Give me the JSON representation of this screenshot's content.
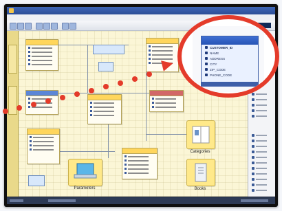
{
  "callout": {
    "entity_title": "CUSTOMERS",
    "fields": [
      "CUSTOMER_ID",
      "NAME",
      "ADDRESS",
      "CITY",
      "ZIP_CODE",
      "PHONE_CODE"
    ]
  },
  "canvas": {
    "illustrations": [
      {
        "caption": "Parameters"
      },
      {
        "caption": "Categories"
      },
      {
        "caption": "Books"
      }
    ]
  },
  "colors": {
    "callout_red": "#e43b2a",
    "entity_header_yellow": "#ffd65c",
    "entity_header_blue": "#5b86d6",
    "canvas_bg": "#fbf6d6"
  },
  "icons": [
    "app-icon",
    "database-table-icon",
    "key-icon",
    "column-icon",
    "tree-node-icon"
  ]
}
